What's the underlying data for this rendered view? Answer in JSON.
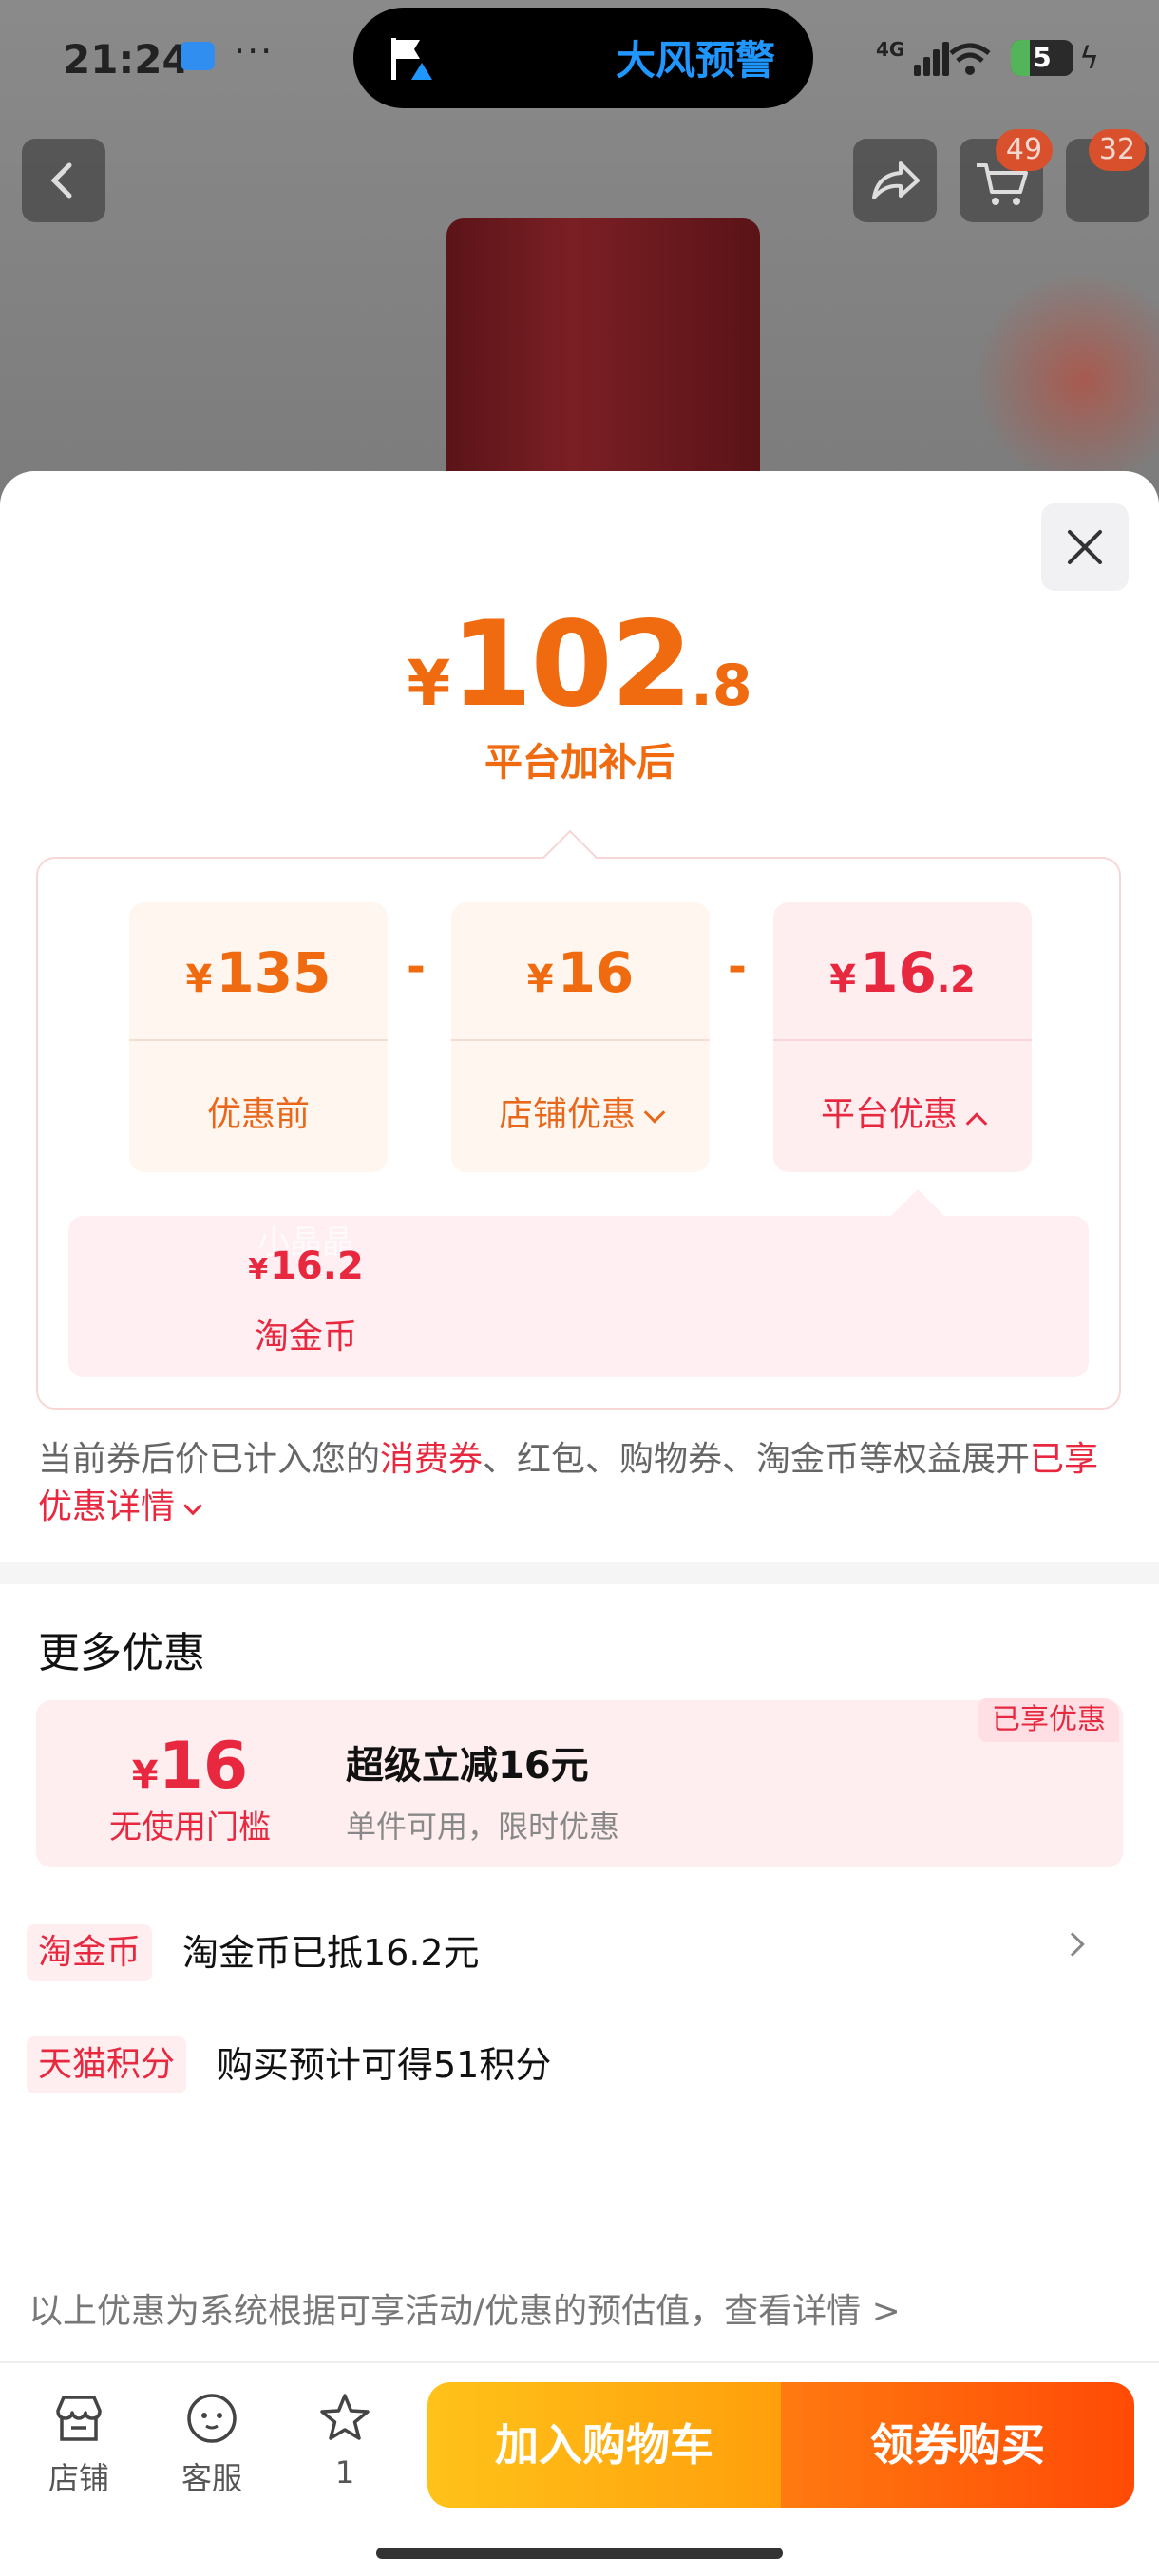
{
  "status_bar": {
    "time": "21:24",
    "dots": "···",
    "island_text": "大风预警",
    "network": "4G",
    "battery": "5",
    "battery_level": 0.3
  },
  "nav": {
    "cart_badge": "49",
    "more_badge": "32"
  },
  "price": {
    "symbol": "¥",
    "integer": "102",
    "decimal": ".8",
    "subtitle": "平台加补后"
  },
  "breakdown": {
    "original": {
      "symbol": "¥",
      "amount": "135",
      "label": "优惠前"
    },
    "shop_discount": {
      "symbol": "¥",
      "amount": "16",
      "label": "店铺优惠"
    },
    "platform_discount": {
      "symbol": "¥",
      "amount": "16",
      "decimal": ".2",
      "label": "平台优惠"
    },
    "minus": "-"
  },
  "platform_detail": {
    "watermark": "小晶晶",
    "symbol": "¥",
    "amount": "16.2",
    "label": "淘金币"
  },
  "note": {
    "part1": "当前券后价已计入您的",
    "highlight1": "消费券",
    "part2": "、红包、购物券、淘金币等权益展开",
    "link": "已享优惠详情"
  },
  "more": {
    "title": "更多优惠",
    "coupon": {
      "tag": "已享优惠",
      "symbol": "¥",
      "amount": "16",
      "condition": "无使用门槛",
      "title": "超级立减16元",
      "desc": "单件可用，限时优惠"
    },
    "rows": [
      {
        "tag": "淘金币",
        "text": "淘金币已抵16.2元"
      },
      {
        "tag": "天猫积分",
        "text": "购买预计可得51积分"
      }
    ]
  },
  "disclaimer": "以上优惠为系统根据可享活动/优惠的预估值，查看详情 >",
  "bottom_bar": {
    "shop": "店铺",
    "service": "客服",
    "fav_count": "1",
    "add_to_cart": "加入购物车",
    "buy": "领券购买"
  },
  "colors": {
    "accent_orange": "#f06a0f",
    "accent_red": "#e7283f",
    "cart_button": "#ffb012",
    "buy_button": "#ff5a08"
  }
}
